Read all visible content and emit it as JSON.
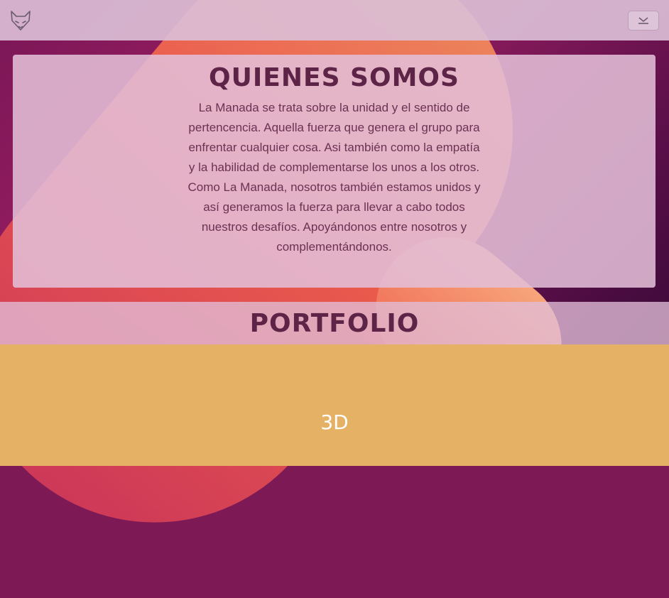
{
  "navbar": {
    "logo_icon": "fox-head-icon",
    "menu_icon": "chevron-down-icon"
  },
  "about": {
    "title": "QUIENES SOMOS",
    "paragraph_1": "La Manada se trata sobre la unidad y el sentido de pertencencia. Aquella fuerza que genera el grupo para enfrentar cualquier cosa. Asi también como la empatía y la habilidad de complementarse los unos a los otros.",
    "paragraph_2": "Como La Manada, nosotros también estamos unidos y así generamos la fuerza para llevar a cabo todos nuestros desafíos. Apoyándonos entre nosotros y complementándonos."
  },
  "portfolio": {
    "title": "PORTFOLIO",
    "tiles": [
      {
        "label": "3D"
      }
    ]
  },
  "colors": {
    "heading": "#5e2447",
    "body_text": "#6a3253",
    "tile_bg": "#e5b164",
    "tile_text": "#ffffff"
  }
}
